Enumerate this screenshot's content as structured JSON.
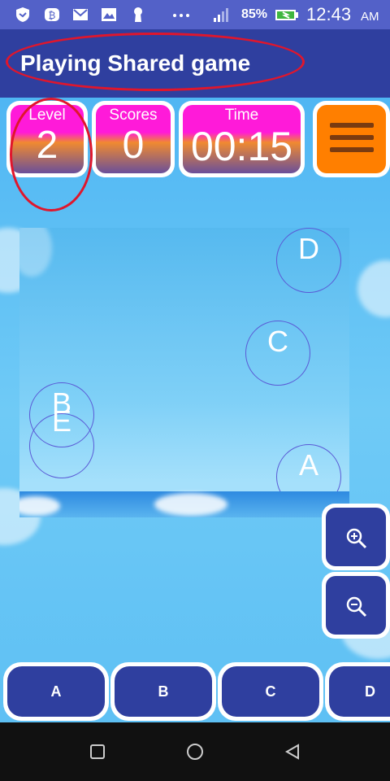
{
  "status_bar": {
    "battery_percent": "85%",
    "time": "12:43",
    "ampm": "AM",
    "icons": [
      "shield-icon",
      "bitcoin-icon",
      "gmail-icon",
      "gallery-icon",
      "keyhole-icon",
      "more-dots-icon",
      "signal-icon",
      "battery-charging-icon"
    ]
  },
  "header": {
    "title": "Playing Shared game"
  },
  "stats": {
    "level": {
      "label": "Level",
      "value": "2"
    },
    "scores": {
      "label": "Scores",
      "value": "0"
    },
    "time": {
      "label": "Time",
      "value": "00:15"
    }
  },
  "board": {
    "nodes": [
      {
        "label": "D"
      },
      {
        "label": "C"
      },
      {
        "label": "B"
      },
      {
        "label": "E"
      },
      {
        "label": "A"
      }
    ]
  },
  "controls": {
    "zoom_in_icon": "zoom-in-icon",
    "zoom_out_icon": "zoom-out-icon",
    "menu_icon": "hamburger-icon"
  },
  "answers": [
    "A",
    "B",
    "C",
    "D"
  ],
  "nav": {
    "icons": [
      "recent-apps-icon",
      "home-icon",
      "back-icon"
    ]
  },
  "colors": {
    "title_bar": "#2f3f9f",
    "status_bar": "#5361c8",
    "button_navy": "#2f3f9f",
    "menu_orange": "#ff7f00",
    "highlight_red": "#e0162c",
    "stat_magenta": "#ff1ad9"
  }
}
